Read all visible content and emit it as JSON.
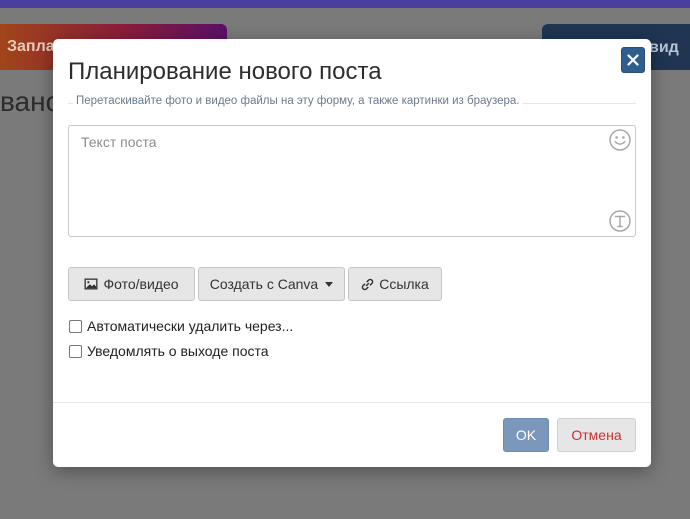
{
  "background": {
    "left_button_label": "Запла",
    "right_button_label": "вид",
    "heading_fragment": "вано"
  },
  "modal": {
    "title": "Планирование нового поста",
    "drop_hint": "Перетаскивайте фото и видео файлы на эту форму, а также картинки из браузера.",
    "post_text": {
      "value": "",
      "placeholder": "Текст поста"
    },
    "toolbar": {
      "photo_label": "Фото/видео",
      "canva_label": "Создать с Canva",
      "link_label": "Ссылка"
    },
    "options": {
      "autodelete_label": "Автоматически удалить через...",
      "autodelete_checked": false,
      "notify_label": "Уведомлять о выходе поста",
      "notify_checked": false
    },
    "footer": {
      "ok_label": "OK",
      "cancel_label": "Отмена"
    },
    "icons": [
      "close-icon",
      "emoji-icon",
      "font-icon",
      "image-icon",
      "caret-down-icon",
      "link-icon"
    ]
  },
  "colors": {
    "topbar": "#4a3f9e",
    "close_button": "#2f5d8e",
    "ok_button": "#7b97bb",
    "cancel_text": "#c9302c"
  }
}
